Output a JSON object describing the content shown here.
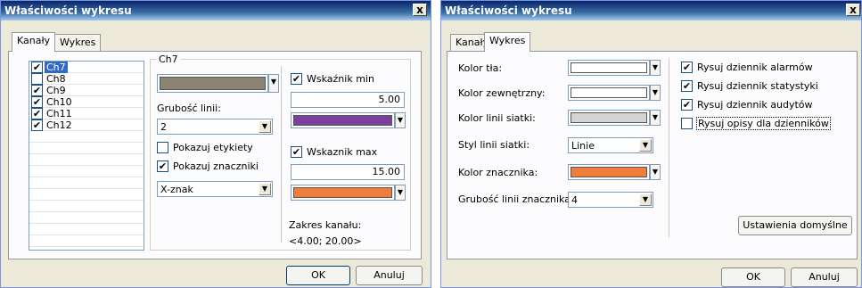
{
  "left_dialog": {
    "title": "Właściwości wykresu",
    "close_label": "x",
    "tabs": [
      "Kanały",
      "Wykres"
    ],
    "channels": [
      {
        "name": "Ch7",
        "checked": true,
        "selected": true
      },
      {
        "name": "Ch8",
        "checked": false,
        "selected": false
      },
      {
        "name": "Ch9",
        "checked": true,
        "selected": false
      },
      {
        "name": "Ch10",
        "checked": true,
        "selected": false
      },
      {
        "name": "Ch11",
        "checked": true,
        "selected": false
      },
      {
        "name": "Ch12",
        "checked": true,
        "selected": false
      }
    ],
    "group_label": "Ch7",
    "line_color": "#8b8472",
    "line_width_label": "Grubość linii:",
    "line_width_value": "2",
    "show_labels": "Pokazuj etykiety",
    "show_markers": "Pokazuj znaczniki",
    "marker_value": "X-znak",
    "min_indicator": "Wskaźnik min",
    "min_value": "5.00",
    "min_color": "#7d3f9c",
    "max_indicator": "Wskaznik max",
    "max_value": "15.00",
    "max_color": "#f07d3c",
    "range_label": "Zakres kanału:",
    "range_value": "<4.00; 20.00>",
    "ok": "OK",
    "cancel": "Anuluj"
  },
  "right_dialog": {
    "title": "Właściwości wykresu",
    "close_label": "x",
    "tabs": [
      "Kanały",
      "Wykres"
    ],
    "bg_color_label": "Kolor tła:",
    "bg_color": "#ffffff",
    "outer_color_label": "Kolor zewnętrzny:",
    "outer_color": "#ffffff",
    "grid_color_label": "Kolor linii siatki:",
    "grid_color": "#d4d4d4",
    "grid_style_label": "Styl linii siatki:",
    "grid_style_value": "Linie",
    "marker_color_label": "Kolor znacznika:",
    "marker_color": "#f07d3c",
    "marker_width_label": "Grubość linii znacznika:",
    "marker_width_value": "4",
    "checkboxes": [
      {
        "label": "Rysuj dziennik alarmów",
        "checked": true
      },
      {
        "label": "Rysuj dziennik statystyki",
        "checked": true
      },
      {
        "label": "Rysuj dziennik audytów",
        "checked": true
      },
      {
        "label": "Rysuj opisy dla dzienników",
        "checked": false
      }
    ],
    "defaults_button": "Ustawienia domyślne",
    "ok": "OK",
    "cancel": "Anuluj"
  }
}
